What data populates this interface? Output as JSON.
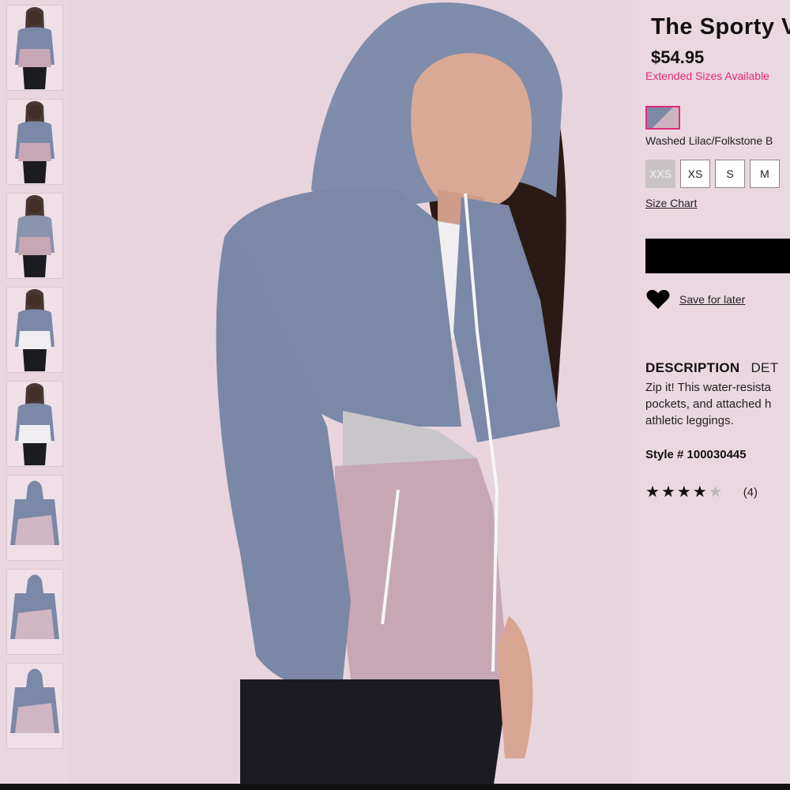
{
  "product": {
    "title": "The Sporty V",
    "price": "$54.95",
    "extended_sizes": "Extended Sizes Available",
    "color_name": "Washed Lilac/Folkstone B",
    "sizes": [
      {
        "label": "XXS",
        "available": false
      },
      {
        "label": "XS",
        "available": true
      },
      {
        "label": "S",
        "available": true
      },
      {
        "label": "M",
        "available": true
      }
    ],
    "size_chart": "Size Chart",
    "save_for_later": "Save for later",
    "tabs": {
      "description": "DESCRIPTION",
      "details": "DET"
    },
    "description_lines": [
      "Zip it! This water-resista",
      "pockets, and attached h",
      "athletic leggings."
    ],
    "style_number": "Style # 100030445",
    "rating": {
      "stars": 4,
      "max": 5,
      "count": "(4)"
    }
  },
  "thumbnails": [
    "model-front-hood-down",
    "model-hood-up",
    "model-back",
    "model-open-jacket",
    "model-open-jacket-alt",
    "jacket-flat-front",
    "jacket-detail",
    "jacket-flat-hood"
  ],
  "colors": {
    "accent": "#e2297a",
    "jacket_blue": "#7c8aa6",
    "jacket_pink": "#cdb3bf",
    "background": "#e9d6df"
  }
}
